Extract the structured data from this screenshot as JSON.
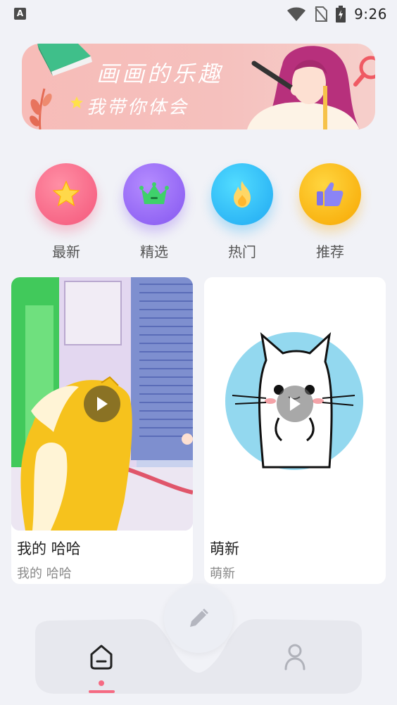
{
  "status_bar": {
    "time": "9:26",
    "app_icon_letter": "A",
    "icons": [
      "wifi-icon",
      "no-sim-icon",
      "battery-charging-icon"
    ]
  },
  "banner": {
    "title": "画画的乐趣",
    "subtitle": "我带你体会",
    "colors": {
      "background": "#f6c2be",
      "text": "#ffffff"
    }
  },
  "categories": [
    {
      "label": "最新",
      "icon": "star-icon",
      "color": "#f4567a"
    },
    {
      "label": "精选",
      "icon": "crown-icon",
      "color": "#8456f0"
    },
    {
      "label": "热门",
      "icon": "flame-icon",
      "color": "#1fa8f2"
    },
    {
      "label": "推荐",
      "icon": "thumbs-up-icon",
      "color": "#f7a600"
    }
  ],
  "cards": [
    {
      "title": "我的 哈哈",
      "subtitle": "我的 哈哈",
      "thumbnail": "cartoon-dog-scene",
      "icon": "play-icon"
    },
    {
      "title": "萌新",
      "subtitle": "萌新",
      "thumbnail": "cartoon-cat-circle",
      "icon": "play-icon"
    }
  ],
  "bottom_nav": {
    "items": [
      {
        "name": "home",
        "icon": "home-icon",
        "active": true
      },
      {
        "name": "create",
        "icon": "pencil-icon",
        "active": false
      },
      {
        "name": "profile",
        "icon": "user-icon",
        "active": false
      }
    ],
    "active_color": "#f56a82"
  }
}
